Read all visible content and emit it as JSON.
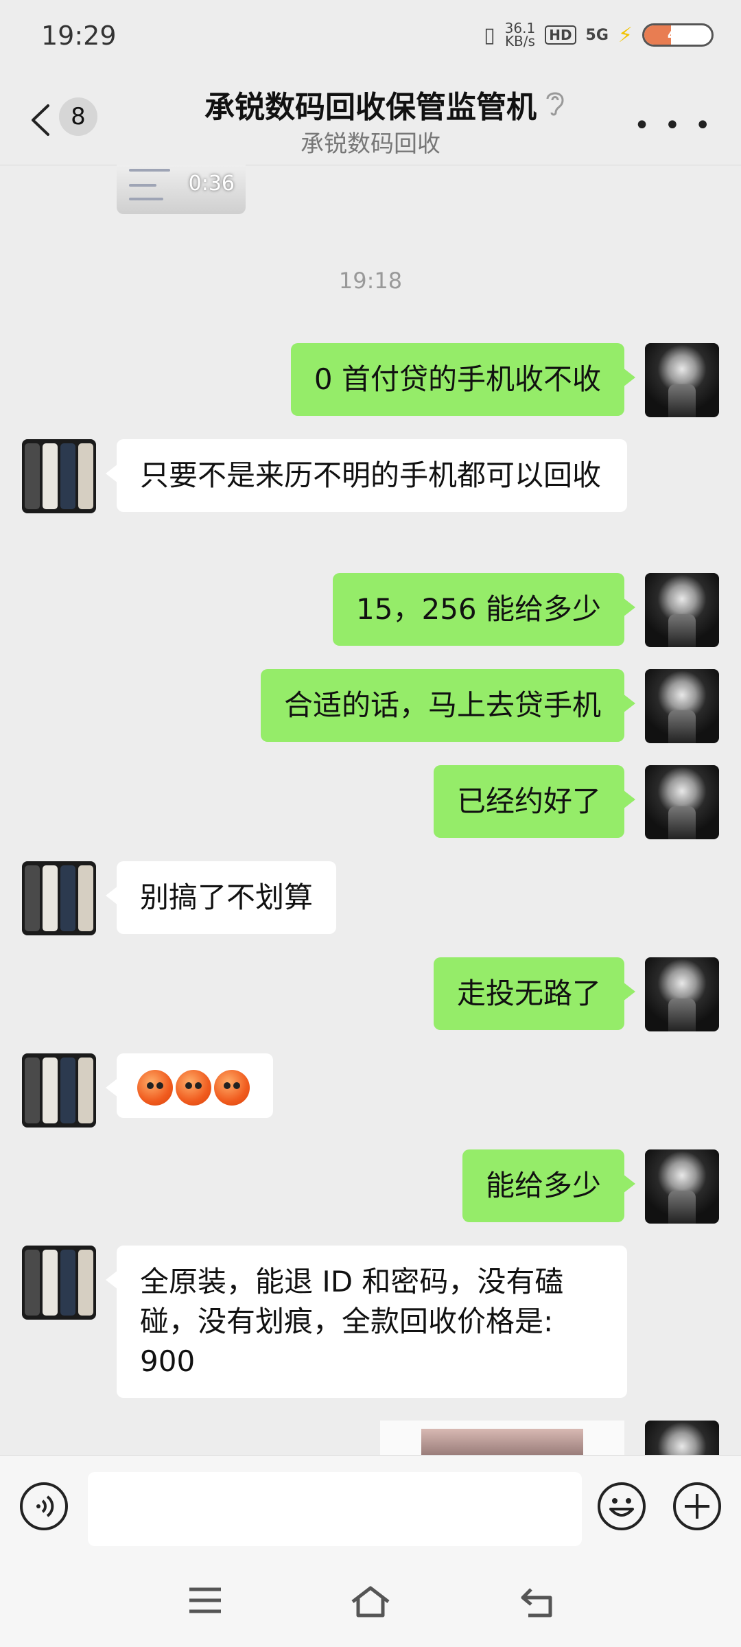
{
  "status": {
    "time": "19:29",
    "net_speed_value": "36.1",
    "net_speed_unit": "KB/s",
    "hd": "HD",
    "signal": "5G",
    "battery": "40",
    "battery_level": 0.4
  },
  "header": {
    "unread_count": "8",
    "title": "承锐数码回收保管监管机",
    "subtitle": "承锐数码回收"
  },
  "chat": {
    "video_duration": "0:36",
    "timestamp": "19:18",
    "messages": [
      {
        "from": "me",
        "text": "0 首付贷的手机收不收"
      },
      {
        "from": "them",
        "text": "只要不是来历不明的手机都可以回收"
      },
      {
        "from": "me",
        "text": "15，256 能给多少"
      },
      {
        "from": "me",
        "text": "合适的话，马上去贷手机"
      },
      {
        "from": "me",
        "text": "已经约好了"
      },
      {
        "from": "them",
        "text": "别搞了不划算"
      },
      {
        "from": "me",
        "text": "走投无路了"
      },
      {
        "from": "them",
        "emoji_count": 3
      },
      {
        "from": "me",
        "text": "能给多少"
      },
      {
        "from": "them",
        "text": "全原装，能退 ID 和密码，没有磕碰，没有划痕，全款回收价格是: 900"
      }
    ]
  },
  "icons": {
    "voice": "voice-icon",
    "emoji": "emoji-face-icon",
    "add": "add-icon",
    "back": "chevron-left-icon",
    "more": "more-icon",
    "ear": "ear-icon"
  },
  "colors": {
    "my_bubble": "#95ec69",
    "their_bubble": "#ffffff",
    "background": "#ededed"
  }
}
